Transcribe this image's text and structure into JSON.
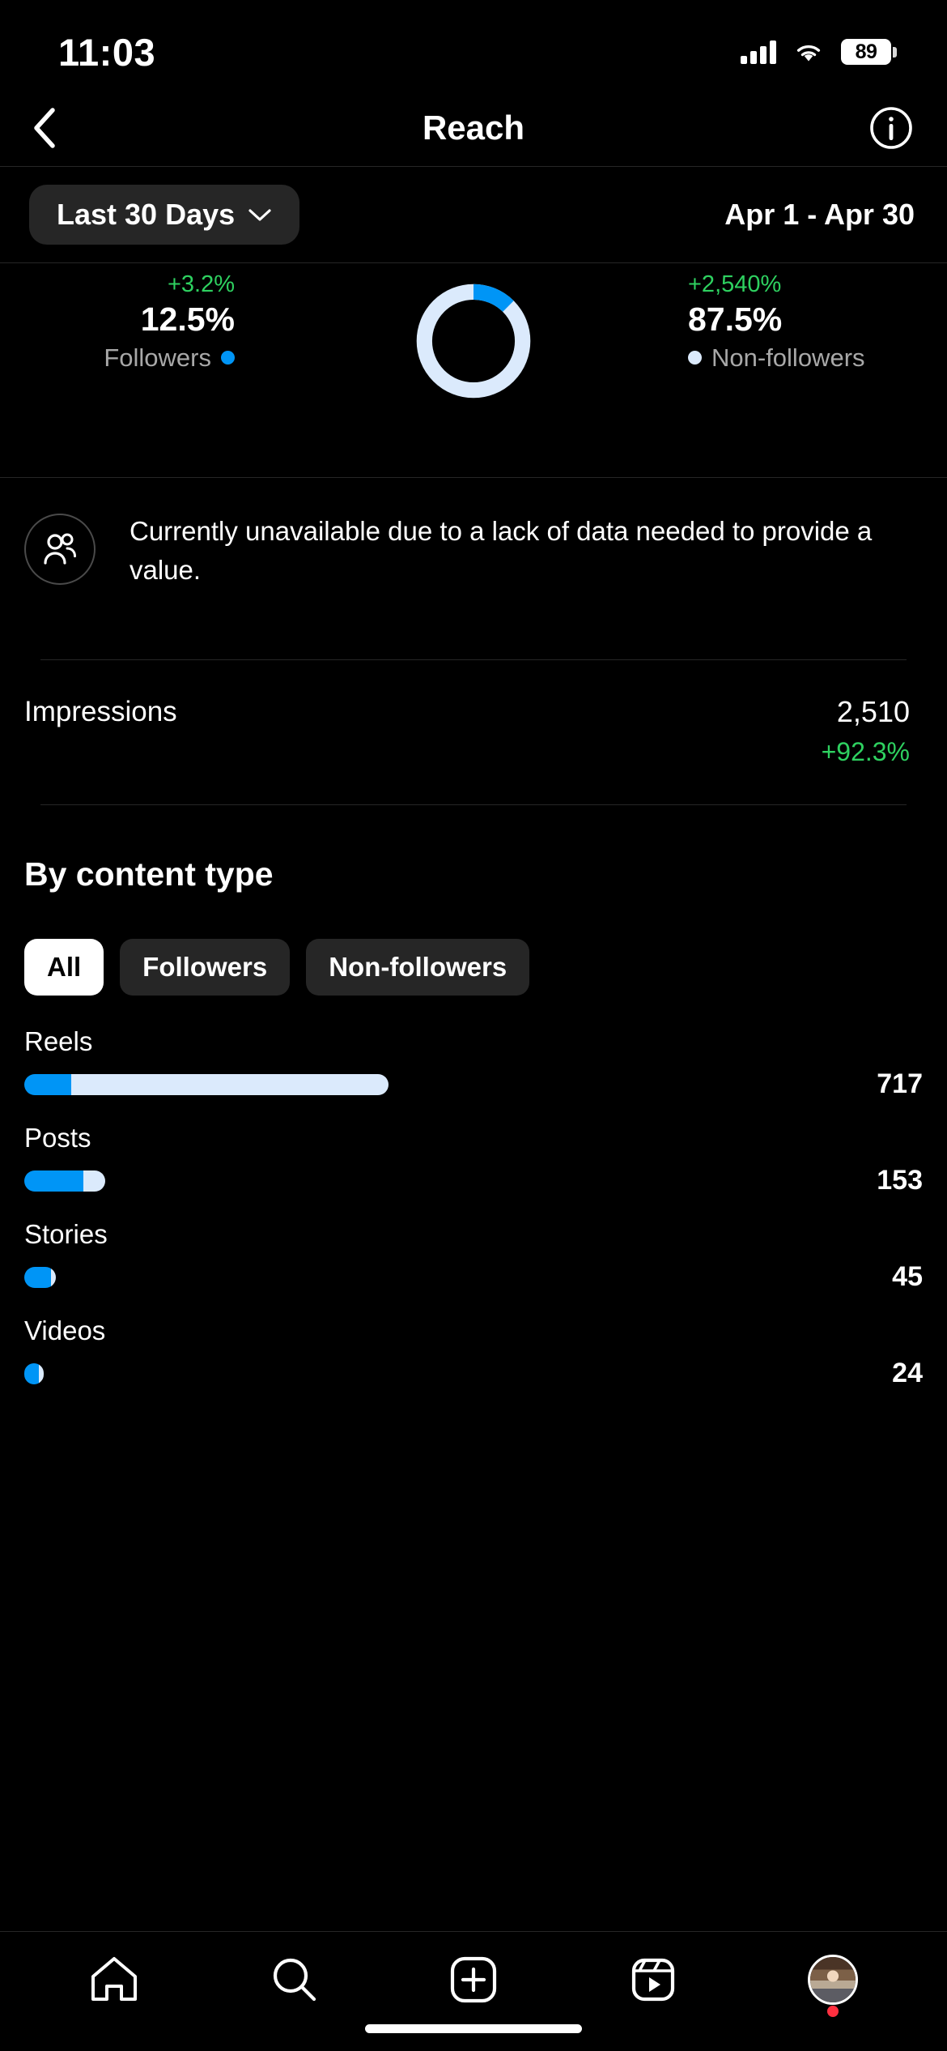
{
  "status_bar": {
    "time": "11:03",
    "battery_level": "89",
    "icons": [
      "cellular-signal-icon",
      "wifi-icon",
      "battery-icon"
    ]
  },
  "header": {
    "back_icon": "chevron-left-icon",
    "title": "Reach",
    "info_icon": "info-circle-icon"
  },
  "filter_bar": {
    "range_label": "Last 30 Days",
    "chevron_icon": "chevron-down-icon",
    "date_range": "Apr 1 - Apr 30"
  },
  "audience_breakdown": {
    "followers": {
      "change": "+3.2%",
      "percent": "12.5%",
      "label": "Followers",
      "color": "#0095F6"
    },
    "non_followers": {
      "change": "+2,540%",
      "percent": "87.5%",
      "label": "Non-followers",
      "color": "#dbeafc"
    }
  },
  "unavailable_notice": {
    "icon": "people-icon",
    "message": "Currently unavailable due to a lack of data needed to provide a value."
  },
  "impressions": {
    "label": "Impressions",
    "value": "2,510",
    "change": "+92.3%",
    "change_color": "#2ED160"
  },
  "by_content_type": {
    "title": "By content type",
    "chips": [
      {
        "label": "All",
        "active": true
      },
      {
        "label": "Followers",
        "active": false
      },
      {
        "label": "Non-followers",
        "active": false
      }
    ],
    "rows": [
      {
        "label": "Reels",
        "value": "717"
      },
      {
        "label": "Posts",
        "value": "153"
      },
      {
        "label": "Stories",
        "value": "45"
      },
      {
        "label": "Videos",
        "value": "24"
      }
    ]
  },
  "chart_data": [
    {
      "type": "pie",
      "title": "Reach by audience type",
      "labels": [
        "Followers",
        "Non-followers"
      ],
      "values": [
        12.5,
        87.5
      ],
      "unit": "%",
      "colors": [
        "#0095F6",
        "#dbeafc"
      ],
      "annotations": [
        "+3.2%",
        "+2,540%"
      ],
      "legend": "sides"
    },
    {
      "type": "bar",
      "title": "By content type",
      "orientation": "horizontal",
      "categories": [
        "Reels",
        "Posts",
        "Stories",
        "Videos"
      ],
      "values": [
        717,
        153,
        45,
        24
      ],
      "series": [
        {
          "name": "Followers",
          "color": "#0095F6",
          "values": [
            90,
            110,
            45,
            24
          ]
        },
        {
          "name": "Non-followers",
          "color": "#dbeafc",
          "values": [
            627,
            43,
            6,
            6
          ]
        }
      ],
      "xlabel": "",
      "ylabel": "",
      "grid": false,
      "legend": "none",
      "bar_pixel_extent": {
        "track_width": 820,
        "reels": {
          "blue": 58,
          "pale": 392
        },
        "posts": {
          "blue": 73,
          "pale": 27
        },
        "stories": {
          "blue": 33,
          "pale": 6
        },
        "videos": {
          "blue": 18,
          "pale": 6
        }
      }
    }
  ],
  "tab_bar": {
    "items": [
      {
        "icon": "home-icon",
        "name": "home"
      },
      {
        "icon": "search-icon",
        "name": "search"
      },
      {
        "icon": "create-plus-icon",
        "name": "create"
      },
      {
        "icon": "reels-icon",
        "name": "reels"
      },
      {
        "icon": "profile-avatar",
        "name": "profile",
        "badge": true
      }
    ]
  }
}
